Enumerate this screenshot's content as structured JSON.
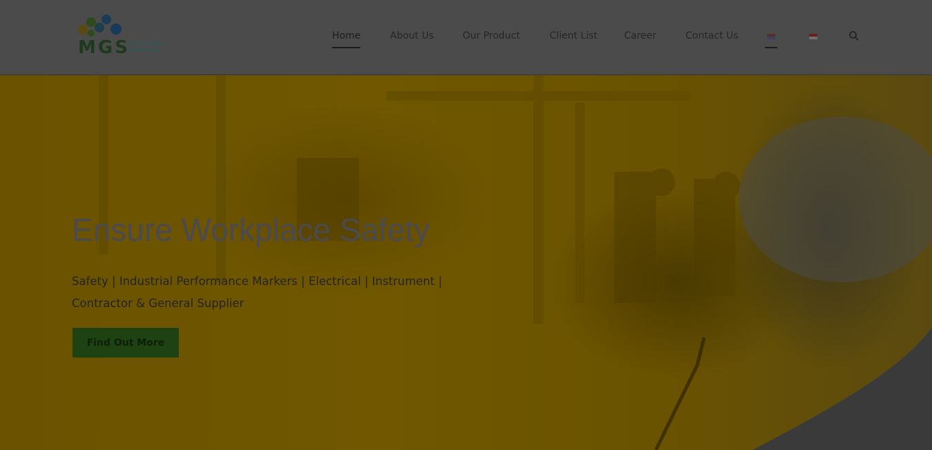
{
  "logo": {
    "text": "MGS",
    "sub_line1": "MULTIGLOBAL",
    "sub_line2": "SAFETINDO"
  },
  "nav": {
    "items": [
      {
        "label": "Home",
        "active": true
      },
      {
        "label": "About Us"
      },
      {
        "label": "Our Product"
      },
      {
        "label": "Client List"
      },
      {
        "label": "Career"
      },
      {
        "label": "Contact Us"
      }
    ],
    "language_flags": [
      "flag-en-icon",
      "flag-id-icon"
    ],
    "search_icon": "search-icon"
  },
  "hero": {
    "title": "Ensure Workplace Safety",
    "subtitle": "Safety | Industrial Performance Markers | Electrical | Instrument | Contractor & General Supplier",
    "cta_label": "Find Out More"
  },
  "colors": {
    "accent": "#1f4212",
    "hero_overlay": "#6a5200"
  }
}
